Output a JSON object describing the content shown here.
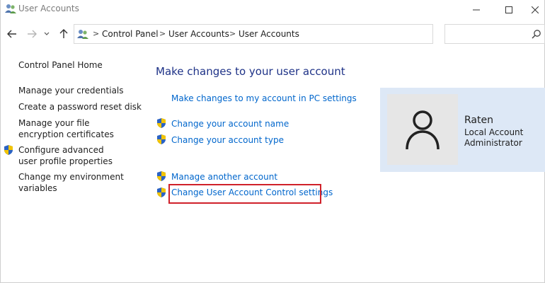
{
  "window": {
    "title": "User Accounts"
  },
  "breadcrumb": [
    "Control Panel",
    "User Accounts",
    "User Accounts"
  ],
  "search": {
    "placeholder": ""
  },
  "sidebar": {
    "home": "Control Panel Home",
    "items": [
      {
        "label": "Manage your credentials"
      },
      {
        "label": "Create a password reset disk"
      },
      {
        "label": "Manage your file encryption certificates"
      },
      {
        "label": "Configure advanced user profile properties"
      },
      {
        "label": "Change my environment variables"
      }
    ]
  },
  "main": {
    "title": "Make changes to your user account",
    "links": {
      "pc_settings": "Make changes to my account in PC settings",
      "change_name": "Change your account name",
      "change_type": "Change your account type",
      "manage_another": "Manage another account",
      "uac": "Change User Account Control settings"
    }
  },
  "account": {
    "name": "Raten",
    "type": "Local Account",
    "role": "Administrator"
  },
  "colors": {
    "link": "#0066cc",
    "title": "#1e3287",
    "highlight": "#d0212a",
    "panel": "#dde8f6"
  }
}
